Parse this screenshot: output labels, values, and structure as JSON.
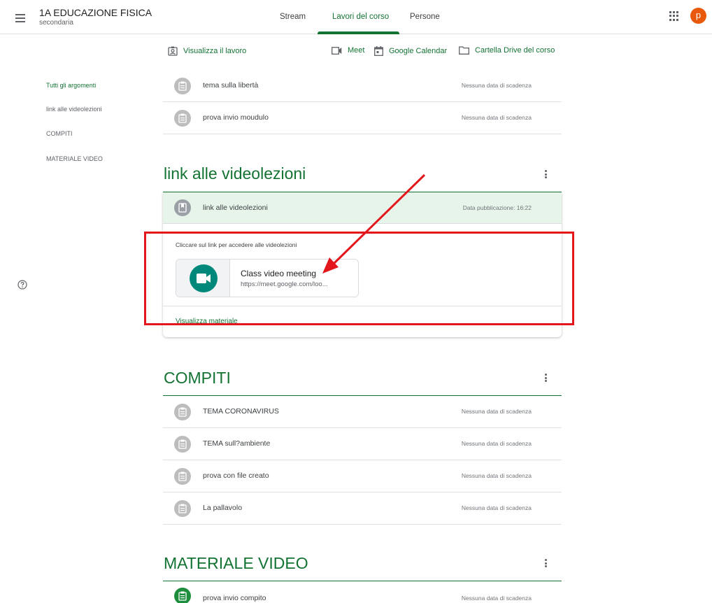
{
  "header": {
    "class_title": "1A EDUCAZIONE FISICA",
    "class_subtitle": "secondaria",
    "avatar_letter": "p",
    "tabs": [
      {
        "label": "Stream",
        "active": false
      },
      {
        "label": "Lavori del corso",
        "active": true
      },
      {
        "label": "Persone",
        "active": false
      }
    ]
  },
  "toolbar": {
    "view_work": "Visualizza il lavoro",
    "meet": "Meet",
    "calendar": "Google Calendar",
    "drive": "Cartella Drive del corso"
  },
  "sidebar": {
    "items": [
      {
        "label": "Tutti gli argomenti",
        "active": true
      },
      {
        "label": "link alle videolezioni",
        "active": false
      },
      {
        "label": "COMPITI",
        "active": false
      },
      {
        "label": "MATERIALE VIDEO",
        "active": false
      }
    ]
  },
  "no_topic_items": [
    {
      "title": "tema sulla libertà",
      "due": "Nessuna data di scadenza"
    },
    {
      "title": "prova invio moudulo",
      "due": "Nessuna data di scadenza"
    }
  ],
  "topics": [
    {
      "name": "link alle videolezioni",
      "material": {
        "title": "link alle videolezioni",
        "published": "Data pubblicazione: 16:22",
        "description": "Cliccare sul link per accedere alle videolezioni",
        "attachment_title": "Class video meeting",
        "attachment_url": "https://meet.google.com/loo...",
        "view_link": "Visualizza materiale"
      }
    },
    {
      "name": "COMPITI",
      "items": [
        {
          "title": "TEMA CORONAVIRUS",
          "due": "Nessuna data di scadenza"
        },
        {
          "title": "TEMA sull?ambiente",
          "due": "Nessuna data di scadenza"
        },
        {
          "title": "prova con file creato",
          "due": "Nessuna data di scadenza"
        },
        {
          "title": "La pallavolo",
          "due": "Nessuna data di scadenza"
        }
      ]
    },
    {
      "name": "MATERIALE VIDEO",
      "items": [
        {
          "title": "prova invio compito",
          "due": "Nessuna data di scadenza"
        }
      ]
    }
  ],
  "colors": {
    "accent": "#137333",
    "avatar": "#e8590c",
    "annotation": "#e2161b"
  }
}
